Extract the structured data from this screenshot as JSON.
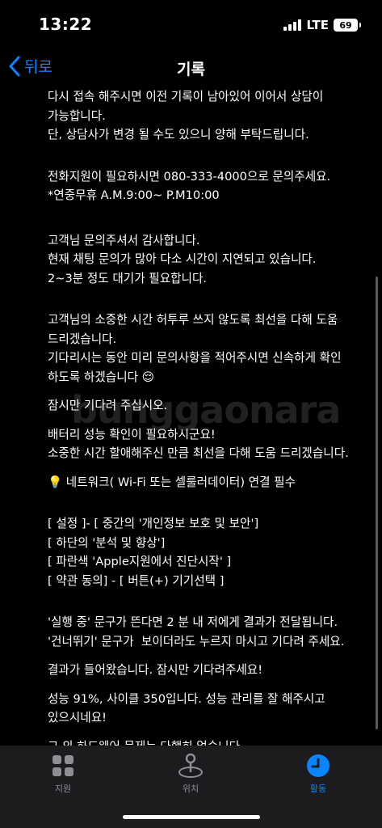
{
  "status": {
    "time": "13:22",
    "network": "LTE",
    "battery": "69"
  },
  "nav": {
    "back_label": "뒤로",
    "title": "기록"
  },
  "messages": [
    "다시 접속 해주시면 이전 기록이 남아있어 이어서 상담이\n가능합니다.\n단, 상담사가 변경 될 수도 있으니 양해 부탁드립니다.",
    "전화지원이 필요하시면 080-333-4000으로 문의주세요.\n*연중무휴 A.M.9:00~ P.M10:00",
    "고객님 문의주셔서 감사합니다.\n현재 채팅 문의가 많아 다소 시간이 지연되고 있습니다.\n2~3분 정도 대기가 필요합니다.",
    "고객님의 소중한 시간 허투루 쓰지 않도록 최선을 다해 도움\n드리겠습니다.\n기다리시는 동안 미리 문의사항을 적어주시면 신속하게 확인\n하도록 하겠습니다 😌",
    "잠시만 기다려 주십시오.",
    "배터리 성능 확인이 필요하시군요!\n소중한 시간 할애해주신 만큼 최선을 다해 도움 드리겠습니다.",
    "💡 네트워크( Wi-Fi 또는 셀룰러데이터) 연결 필수",
    "[ 설정 ]- [ 중간의 '개인정보 보호 및 보안']\n[ 하단의 '분석 및 향상']\n[ 파란색 'Apple지원에서 진단시작' ]\n[ 약관 동의] - [ 버튼(+) 기기선택 ]",
    "'실행 중' 문구가 뜬다면 2 분 내 저에게 결과가 전달됩니다.\n'건너뛰기' 문구가  보이더라도 누르지 마시고 기다려 주세요.",
    "결과가 들어왔습니다. 잠시만 기다려주세요!",
    "성능 91%, 사이클 350입니다. 성능 관리를 잘 해주시고\n있으시네요!",
    "그 외 하드웨어 문제는 다행히 없습니다."
  ],
  "watermark": "bunggaonara",
  "tabs": [
    {
      "label": "지원",
      "icon": "grid-icon"
    },
    {
      "label": "위치",
      "icon": "location-pin-icon"
    },
    {
      "label": "활동",
      "icon": "clock-icon"
    }
  ],
  "colors": {
    "accent": "#0a84ff",
    "background": "#000000",
    "tabbar": "#1c1c1e",
    "inactive": "#8e8e93"
  }
}
